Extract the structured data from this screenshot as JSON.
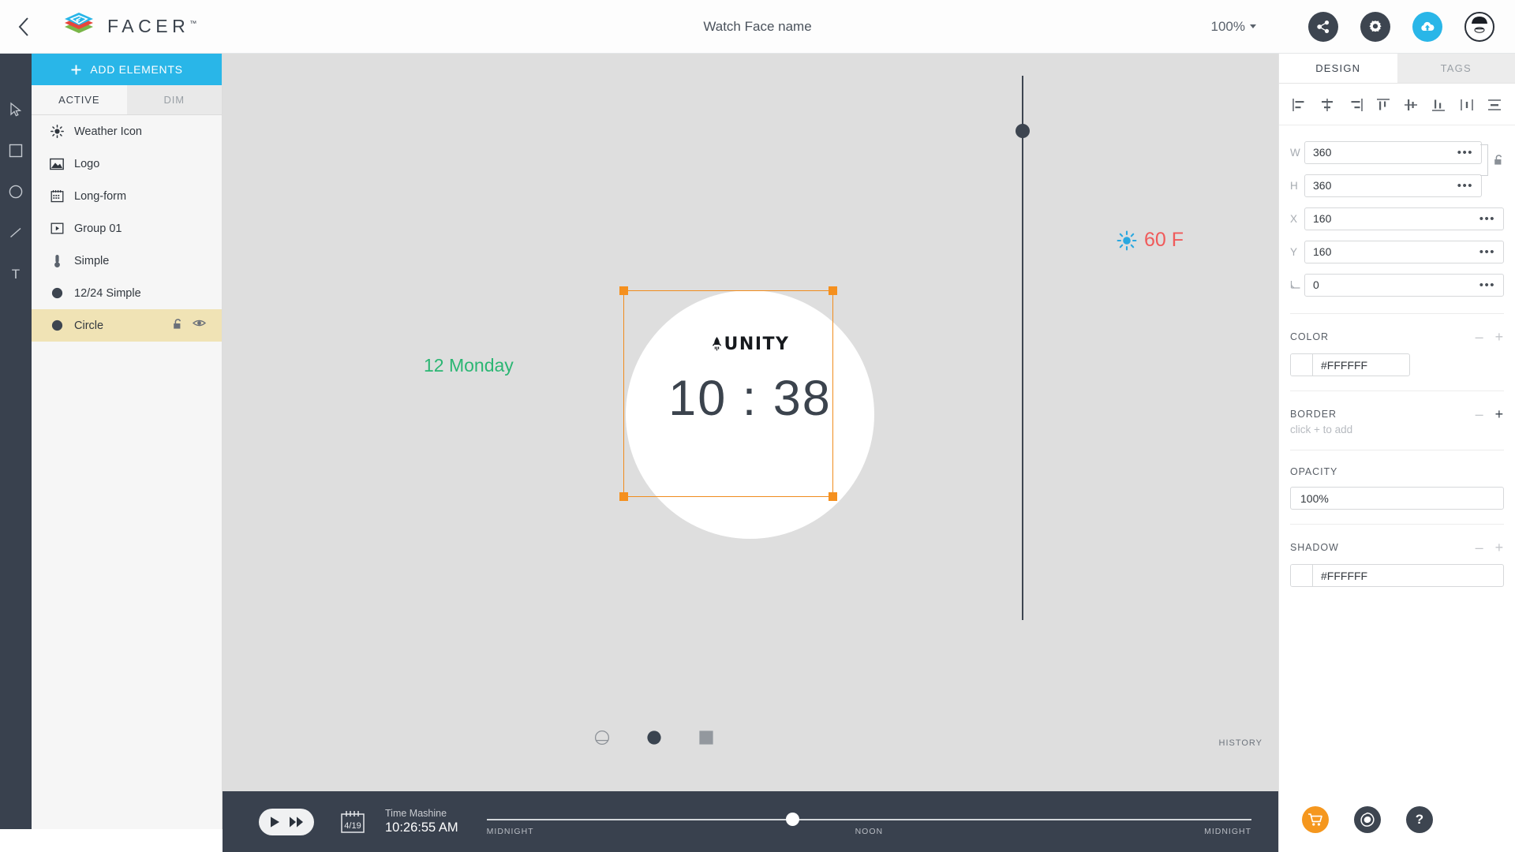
{
  "topbar": {
    "back_icon": "chevron-left-icon",
    "brand": "FACER",
    "brand_tm": "™",
    "face_title": "Watch Face name",
    "zoom_level": "100%",
    "actions": [
      {
        "name": "share-button",
        "icon": "share-icon"
      },
      {
        "name": "settings-button",
        "icon": "gear-icon"
      },
      {
        "name": "publish-button",
        "icon": "cloud-upload-icon"
      },
      {
        "name": "account-avatar",
        "icon": "avatar-icon"
      }
    ]
  },
  "toolrail": {
    "tools": [
      {
        "name": "select-tool",
        "icon": "cursor-icon"
      },
      {
        "name": "rectangle-tool",
        "icon": "square-icon"
      },
      {
        "name": "ellipse-tool",
        "icon": "circle-icon"
      },
      {
        "name": "line-tool",
        "icon": "line-icon"
      },
      {
        "name": "text-tool",
        "icon": "text-icon",
        "glyph": "T"
      }
    ]
  },
  "layers": {
    "add_elements_label": "ADD ELEMENTS",
    "tabs": [
      {
        "label": "ACTIVE",
        "active": true
      },
      {
        "label": "DIM",
        "active": false
      }
    ],
    "items": [
      {
        "label": "Weather Icon",
        "icon": "sun-icon",
        "selected": false
      },
      {
        "label": "Logo",
        "icon": "image-icon",
        "selected": false
      },
      {
        "label": "Long-form",
        "icon": "calendar-icon",
        "selected": false
      },
      {
        "label": "Group 01",
        "icon": "group-icon",
        "selected": false
      },
      {
        "label": "Simple",
        "icon": "thermometer-icon",
        "selected": false
      },
      {
        "label": "12/24 Simple",
        "icon": "filled-circle-icon",
        "selected": false
      },
      {
        "label": "Circle",
        "icon": "filled-circle-icon",
        "selected": true,
        "lock_icon": "unlock-icon",
        "visibility_icon": "eye-icon"
      }
    ]
  },
  "canvas": {
    "weather": {
      "temp": "60 F",
      "icon": "sun-icon"
    },
    "date": "12 Monday",
    "watch": {
      "logo_text": "UNITY",
      "logo_icon": "rocket-icon",
      "time": "10 : 38"
    },
    "shape_options": [
      {
        "name": "shape-flat-tire",
        "selected": false
      },
      {
        "name": "shape-round",
        "selected": true
      },
      {
        "name": "shape-square",
        "selected": false
      }
    ],
    "history_label": "HISTORY"
  },
  "timeline": {
    "play_icon": "play-icon",
    "forward_icon": "fast-forward-icon",
    "calendar_date": "4/19",
    "machine_label": "Time Mashine",
    "machine_time": "10:26:55 AM",
    "ticks": {
      "left": "MIDNIGHT",
      "center": "NOON",
      "right": "MIDNIGHT"
    },
    "knob_position_pct": 40
  },
  "rightpanel": {
    "tabs": [
      {
        "label": "DESIGN",
        "active": true
      },
      {
        "label": "TAGS",
        "active": false
      }
    ],
    "align_buttons": [
      "align-left-icon",
      "align-center-horizontal-icon",
      "align-right-icon",
      "align-top-icon",
      "align-middle-vertical-icon",
      "align-bottom-icon",
      "distribute-horizontal-icon",
      "distribute-vertical-icon"
    ],
    "properties": [
      {
        "label": "W",
        "value": "360",
        "name": "width-input"
      },
      {
        "label": "H",
        "value": "360",
        "name": "height-input"
      },
      {
        "label": "X",
        "value": "160",
        "name": "x-input"
      },
      {
        "label": "Y",
        "value": "160",
        "name": "y-input"
      },
      {
        "label": "∠",
        "value": "0",
        "name": "rotation-input"
      }
    ],
    "link_lock_icon": "unlock-icon",
    "color": {
      "title": "COLOR",
      "value": "#FFFFFF",
      "minus": "–",
      "plus": "+"
    },
    "border": {
      "title": "BORDER",
      "hint": "click + to add",
      "minus": "–",
      "plus": "+"
    },
    "opacity": {
      "title": "OPACITY",
      "value": "100%"
    },
    "shadow": {
      "title": "SHADOW",
      "value": "#FFFFFF",
      "minus": "–",
      "plus": "+"
    }
  },
  "bottom_actions": [
    {
      "name": "shop-button",
      "icon": "cart-icon"
    },
    {
      "name": "inspiration-button",
      "icon": "blob-icon"
    },
    {
      "name": "help-button",
      "icon": "question-icon",
      "glyph": "?"
    }
  ],
  "colors": {
    "accent_blue": "#29b6e8",
    "selection_orange": "#f5901e",
    "panel_dark": "#39414e",
    "layer_selected": "#f0e3b5",
    "temp_red": "#f05a5a",
    "date_green": "#2bb673",
    "cart_orange": "#f5971e"
  }
}
